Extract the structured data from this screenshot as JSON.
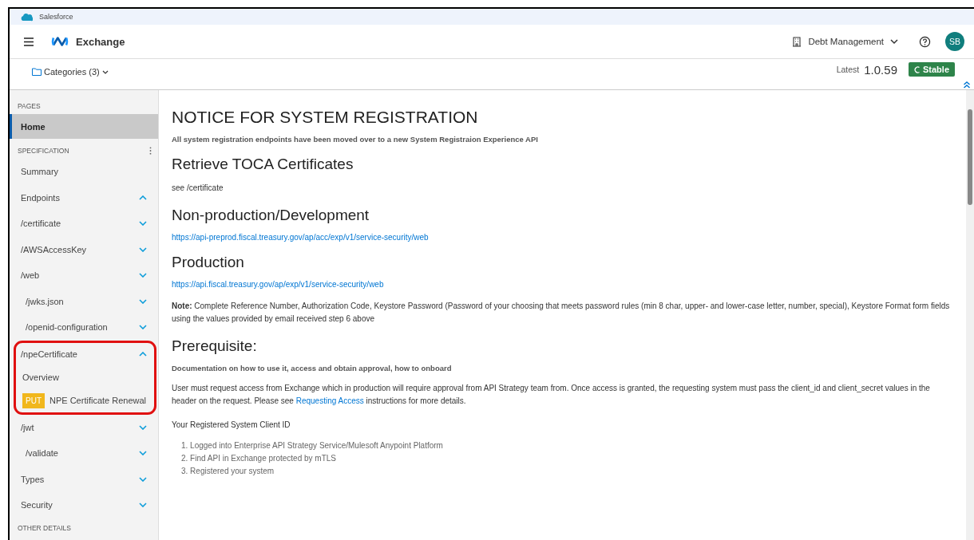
{
  "browser_bar": {
    "title": "Salesforce"
  },
  "header": {
    "app_name": "Exchange",
    "organization": "Debt Management",
    "avatar_initials": "SB"
  },
  "subheader": {
    "categories": "Categories (3)",
    "version_label": "Latest",
    "version": "1.0.59",
    "status": "Stable"
  },
  "sidebar": {
    "sections": [
      {
        "title": "PAGES",
        "items": [
          {
            "label": "Home",
            "selected": true
          }
        ]
      },
      {
        "title": "SPECIFICATION",
        "has_menu": true,
        "items": [
          {
            "label": "Summary",
            "selected": false
          },
          {
            "label": "Endpoints",
            "selected": false,
            "expanded": true
          },
          {
            "label": "/certificate",
            "selected": false,
            "expanded": false
          },
          {
            "label": "/AWSAccessKey",
            "selected": false,
            "expanded": false
          },
          {
            "label": "/web",
            "selected": false,
            "expanded": false,
            "children": [
              {
                "label": "/jwks.json",
                "selected": false,
                "expanded": false
              },
              {
                "label": "/openid-configuration",
                "selected": false,
                "expanded": false
              }
            ]
          },
          {
            "label": "/npeCertificate",
            "selected": false,
            "expanded": true,
            "highlighted": true,
            "children": [
              {
                "label": "Overview",
                "selected": false
              },
              {
                "label": "NPE Certificate Renewal",
                "method": "PUT",
                "selected": false
              }
            ]
          },
          {
            "label": "/jwt",
            "selected": false,
            "expanded": false,
            "children": [
              {
                "label": "/validate",
                "selected": false,
                "expanded": false
              }
            ]
          },
          {
            "label": "Types",
            "selected": false,
            "expanded": false
          },
          {
            "label": "Security",
            "selected": false,
            "expanded": false
          }
        ]
      },
      {
        "title": "OTHER DETAILS"
      }
    ]
  },
  "content": [
    {
      "kind": "h1",
      "text": "NOTICE FOR SYSTEM REGISTRATION"
    },
    {
      "kind": "lead",
      "text": "All system registration endpoints have been moved over to a new System Registraion Experience API"
    },
    {
      "kind": "h2",
      "text": "Retrieve TOCA Certificates"
    },
    {
      "kind": "para",
      "parts": [
        {
          "text": "see /certificate"
        }
      ]
    },
    {
      "kind": "h2",
      "text": "Non-production/Development"
    },
    {
      "kind": "link",
      "text": "https://api-preprod.fiscal.treasury.gov/ap/acc/exp/v1/service-security/web"
    },
    {
      "kind": "h2",
      "text": "Production"
    },
    {
      "kind": "link",
      "text": "https://api.fiscal.treasury.gov/ap/exp/v1/service-security/web"
    },
    {
      "kind": "para",
      "parts": [
        {
          "text": "**Note:**  Complete Reference Number, Authorization Code, Keystore Password (Password of your choosing that meets password rules (min 8 char, upper- and lower-case letter, number, special), Keystore Format form fields using the values provided by email received step 6 above"
        }
      ]
    },
    {
      "kind": "h2",
      "text": "Prerequisite:"
    },
    {
      "kind": "lead",
      "text": "Documentation on how to use it, access and obtain approval, how to onboard"
    },
    {
      "kind": "para",
      "parts": [
        {
          "text": "User must request access from Exchange which in production will require approval from API Strategy team from.  Once access is granted, the requesting system must pass the client_id and client_secret values in the header on the request.  Please see "
        },
        {
          "text": "Requesting Access",
          "link": true
        },
        {
          "text": " instructions for more details."
        }
      ]
    },
    {
      "kind": "para",
      "parts": [
        {
          "text": "Your Registered System Client ID"
        }
      ]
    },
    {
      "kind": "list",
      "items": [
        {
          "marker": "1.",
          "text": "Logged into Enterprise API Strategy Service/Mulesoft Anypoint Platform"
        },
        {
          "marker": "2.",
          "text": "Find API in Exchange protected by mTLS"
        },
        {
          "marker": "3.",
          "text": "Registered your system"
        }
      ]
    }
  ]
}
